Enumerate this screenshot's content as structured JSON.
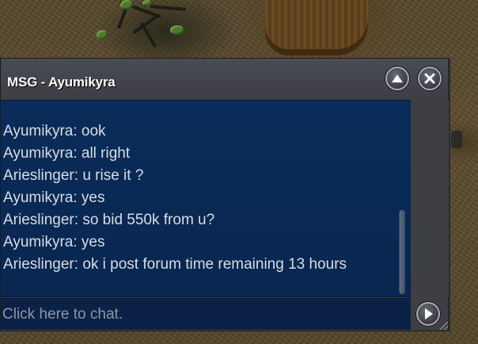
{
  "window": {
    "title": "MSG - Ayumikyra"
  },
  "chat": {
    "lines": [
      "Ayumikyra: ook",
      "Ayumikyra: all right",
      "Arieslinger: u rise it ?",
      "Ayumikyra: yes",
      "Arieslinger: so bid 550k from u?",
      "Ayumikyra: yes",
      "Arieslinger: ok i post forum time remaining 13 hours"
    ]
  },
  "input": {
    "placeholder": "Click here to chat."
  },
  "icons": {
    "minimize": "chevron-up-icon",
    "close": "close-icon",
    "send": "play-arrow-icon"
  },
  "colors": {
    "chat_background": "#0a2c5a",
    "chat_text": "#d9dde3",
    "frame": "#3d3f45",
    "title_text": "#ffffff"
  }
}
